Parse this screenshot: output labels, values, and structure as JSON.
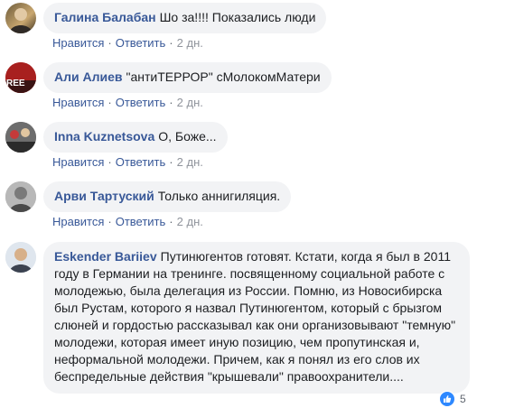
{
  "comments": [
    {
      "author": "Галина Балабан",
      "text": "Шо за!!!! Показались люди",
      "actions": {
        "like": "Нравится",
        "reply": "Ответить",
        "time": "2 дн."
      }
    },
    {
      "author": "Али Алиев",
      "text": "\"антиТЕРРОР\" сМолокомМатери",
      "avatar_text": "REE",
      "actions": {
        "like": "Нравится",
        "reply": "Ответить",
        "time": "2 дн."
      }
    },
    {
      "author": "Inna Kuznetsova",
      "text": "О, Боже...",
      "actions": {
        "like": "Нравится",
        "reply": "Ответить",
        "time": "2 дн."
      }
    },
    {
      "author": "Арви Тартуский",
      "text": "Только аннигиляция.",
      "actions": {
        "like": "Нравится",
        "reply": "Ответить",
        "time": "2 дн."
      }
    },
    {
      "author": "Eskender Bariiev",
      "text": "Путинюгентов готовят. Кстати, когда я был в 2011 году в Германии на тренинге. посвященному социальной работе с молодежью, была делегация из России. Помню, из Новосибирска был Рустам, которого я назвал Путинюгентом, который с брызгом слюней и гордостью рассказывал как они организовывают \"темную\" молодежи, которая имеет иную позицию, чем пропутинская и, неформальной молодежи. Причем, как я понял из его слов их беспредельные действия \"крышевали\" правоохранители....",
      "reactions": {
        "icon": "like-icon",
        "count": "5"
      }
    }
  ],
  "separator": "·",
  "colors": {
    "author": "#385898",
    "bubble": "#f2f3f5",
    "meta": "#606770",
    "like": "#2d88ff"
  }
}
